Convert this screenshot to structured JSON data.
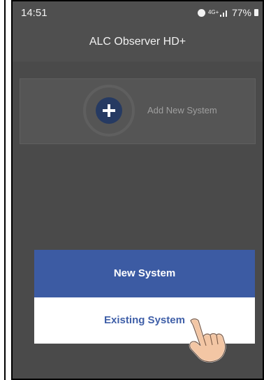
{
  "status_bar": {
    "time": "14:51",
    "network_badge": "4G+",
    "battery_percent": "77%"
  },
  "app_bar": {
    "title": "ALC Observer HD+"
  },
  "main": {
    "add_system_label": "Add New System"
  },
  "dialog": {
    "new_system_label": "New System",
    "existing_system_label": "Existing System"
  },
  "colors": {
    "primary_blue": "#3c5ba3",
    "dark_overlay": "#4a4a4a",
    "white": "#ffffff"
  },
  "icons": {
    "add": "plus-icon",
    "cursor": "hand-pointer-icon",
    "alarm": "alarm-icon",
    "signal": "signal-icon",
    "battery": "battery-icon"
  }
}
